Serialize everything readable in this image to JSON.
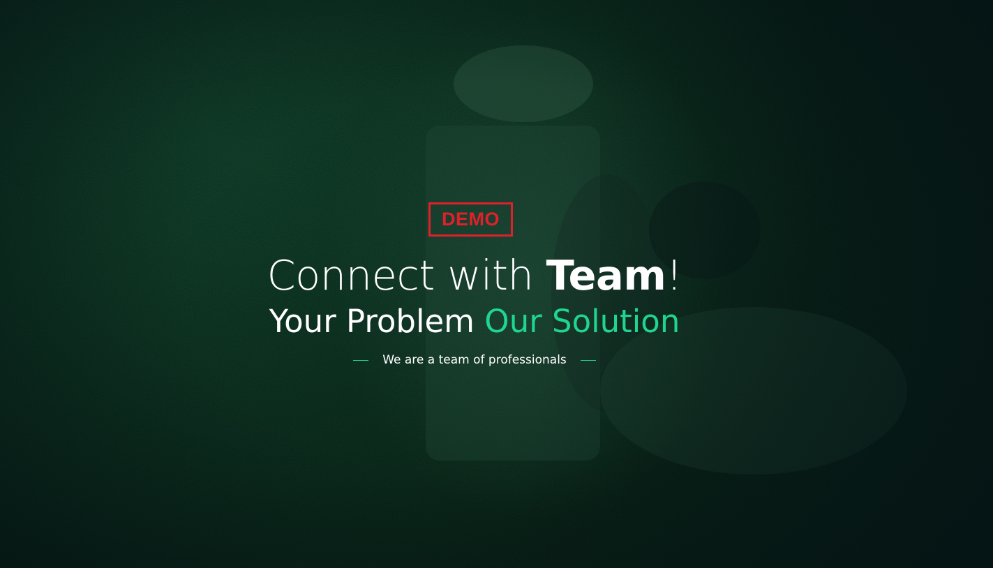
{
  "hero": {
    "badge": "DEMO",
    "headline": {
      "lead": "Connect with ",
      "emphasis": "Team",
      "trail": "!"
    },
    "subhead": {
      "lead": "Your Problem ",
      "accent": "Our Solution"
    },
    "tagline": "We are a team of professionals"
  },
  "colors": {
    "accent": "#1fd68e",
    "badge": "#e0202a",
    "text": "#ffffff",
    "background": "#0e3323"
  }
}
